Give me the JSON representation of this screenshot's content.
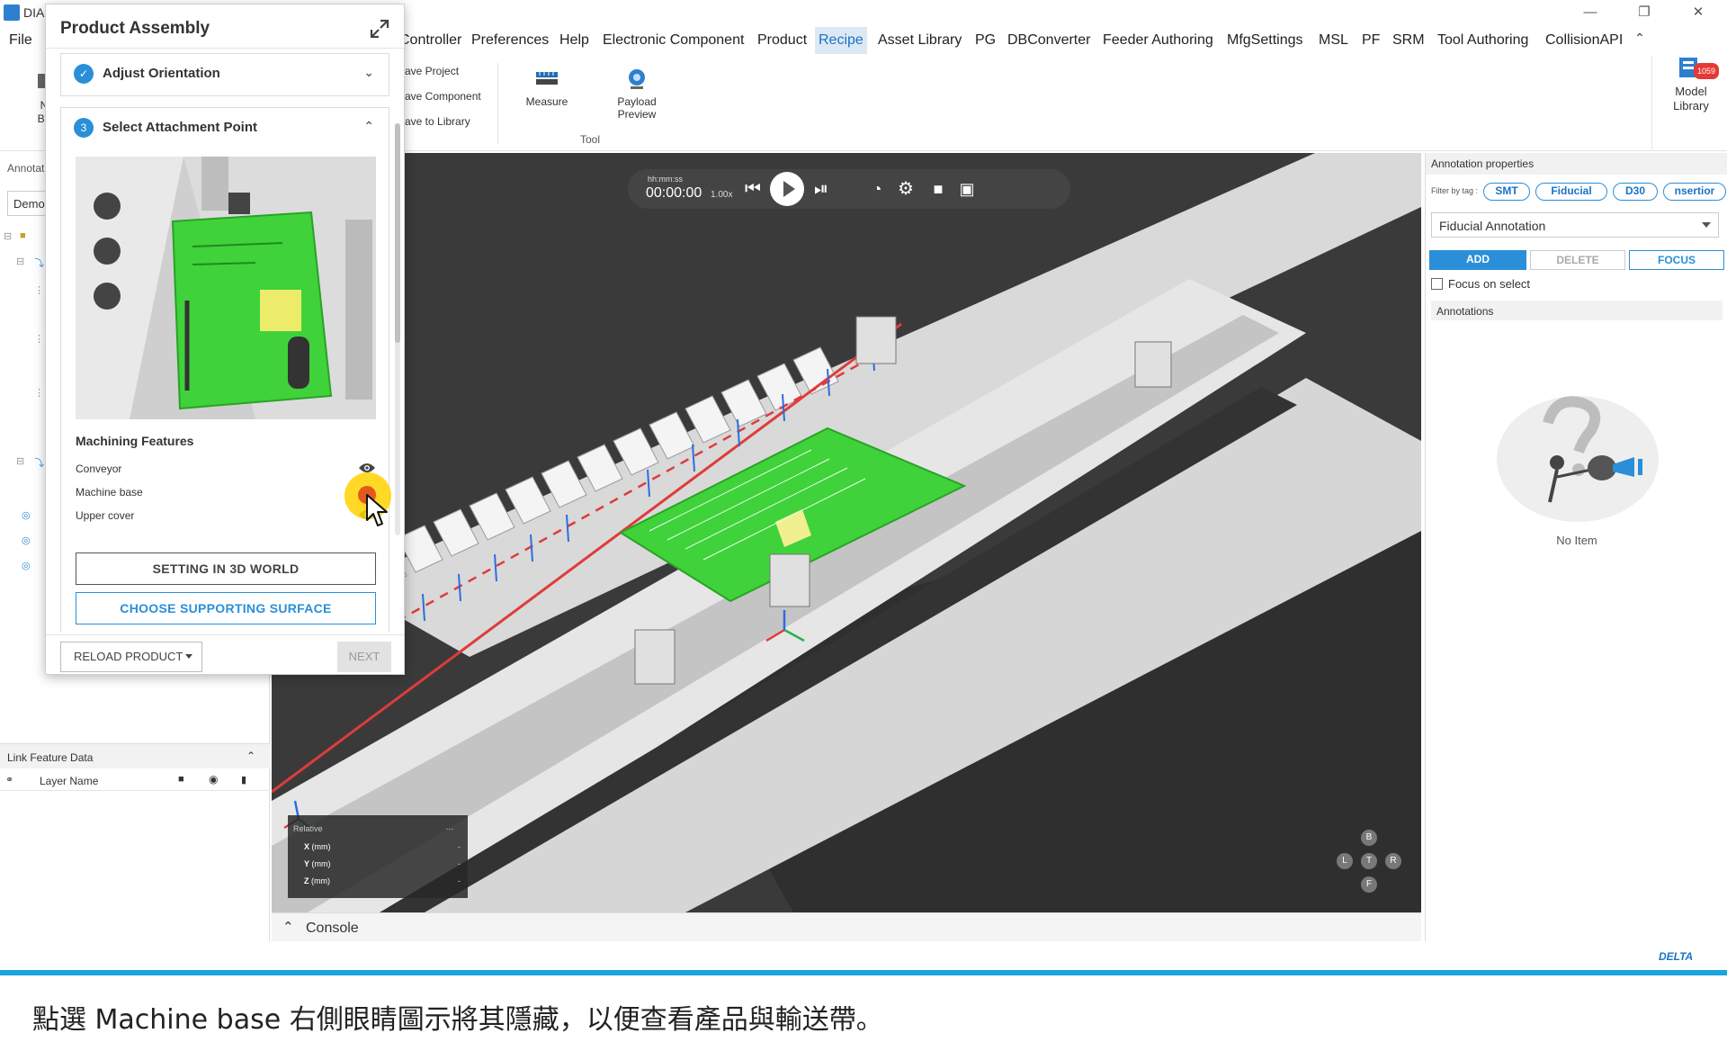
{
  "window": {
    "title": "DIA",
    "minimize": "—",
    "restore": "❐",
    "close": "✕"
  },
  "menu": {
    "items": [
      "File",
      "Controller",
      "Preferences",
      "Help",
      "Electronic Component",
      "Product",
      "Recipe",
      "Asset Library",
      "PG",
      "DBConverter",
      "Feeder Authoring",
      "MfgSettings",
      "MSL",
      "PF",
      "SRM",
      "Tool Authoring",
      "CollisionAPI"
    ],
    "active": "Recipe"
  },
  "ribbon": {
    "new_board": "N\nBo",
    "save_project": "ave Project",
    "save_component": "ave Component",
    "save_to_library": "ave to Library",
    "measure": "Measure",
    "payload_preview": "Payload\nPreview",
    "group_tool": "Tool",
    "model_library": "Model\nLibrary",
    "model_library_badge": "1059"
  },
  "left_panel": {
    "header": "Annotat",
    "dropdown": "Demo",
    "link_feature_data": "Link Feature Data",
    "layer_name": "Layer Name"
  },
  "product_assembly": {
    "title": "Product Assembly",
    "step_done": {
      "title": "Adjust Orientation"
    },
    "step_active": {
      "number": "3",
      "title": "Select Attachment Point"
    },
    "machining_features_title": "Machining Features",
    "features": [
      {
        "label": "Conveyor",
        "visible": true
      },
      {
        "label": "Machine base",
        "visible": true
      },
      {
        "label": "Upper cover",
        "visible": true
      }
    ],
    "btn_setting": "SETTING IN 3D WORLD",
    "btn_surface": "CHOOSE SUPPORTING SURFACE",
    "btn_reload": "RELOAD PRODUCT",
    "btn_next": "NEXT"
  },
  "viewport": {
    "time_label": "hh:mm:ss",
    "time": "00:00:00",
    "speed": "1.00x",
    "coords_title": "Relative",
    "coords_menu": "...",
    "coords": [
      {
        "axis": "X",
        "unit": "(mm)",
        "value": "-"
      },
      {
        "axis": "Y",
        "unit": "(mm)",
        "value": "-"
      },
      {
        "axis": "Z",
        "unit": "(mm)",
        "value": "-"
      }
    ],
    "navcube": {
      "back": "B",
      "left": "L",
      "top": "T",
      "right": "R",
      "front": "F"
    }
  },
  "console": {
    "label": "Console"
  },
  "annotation_panel": {
    "header": "Annotation properties",
    "filter_label": "Filter by tag :",
    "tags": [
      "SMT",
      "Fiducial",
      "D30",
      "nsertior"
    ],
    "type_select": "Fiducial Annotation",
    "btn_add": "ADD",
    "btn_delete": "DELETE",
    "btn_focus": "FOCUS",
    "focus_on_select": "Focus on select",
    "annotations_header": "Annotations",
    "empty_text": "No Item"
  },
  "branding": "DELTA",
  "caption": "點選 Machine base 右側眼睛圖示將其隱藏，以便查看產品與輸送帶。",
  "colors": {
    "accent": "#2a8fd8",
    "pcb_green": "#3fd23a",
    "caption_bar": "#1aa3dd",
    "cursor_highlight": "#ffd200"
  }
}
